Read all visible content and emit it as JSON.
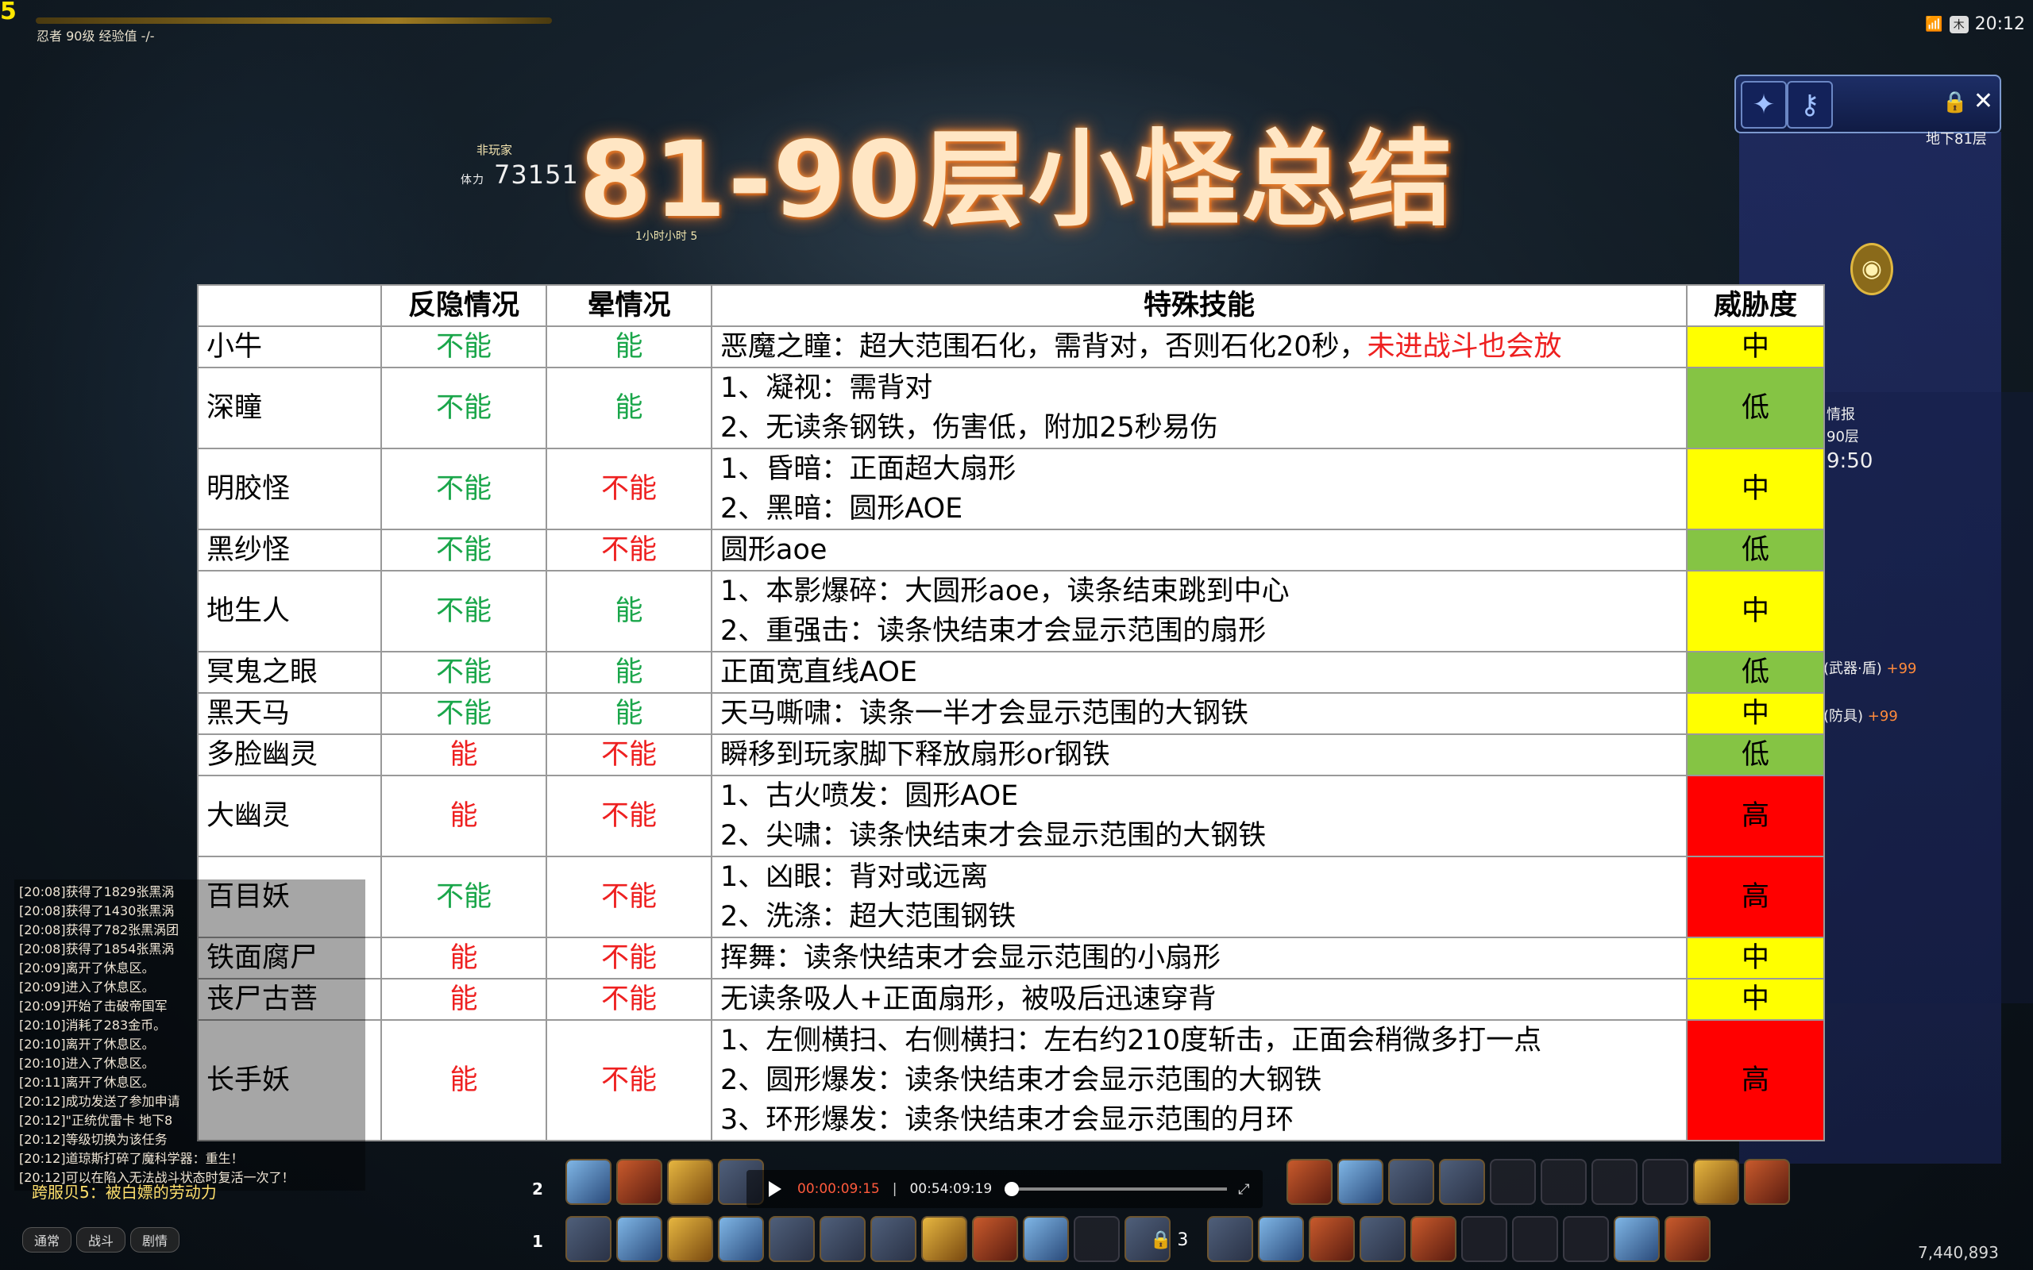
{
  "hud": {
    "corner_number": "5",
    "job_line": "忍者 90级  经验值 -/-",
    "clock": "20:12",
    "clock_badge": "木",
    "target_label": "非玩家",
    "target_hp_label": "体力",
    "target_hp": "73151",
    "target_timer": "1小时小时 5",
    "floor": "地下81层",
    "gil": "7,440,893"
  },
  "title": "81-90层小怪总结",
  "table": {
    "headers": [
      "",
      "反隐情况",
      "晕情况",
      "特殊技能",
      "威胁度"
    ],
    "rows": [
      {
        "name": "小牛",
        "hidden": "不能",
        "hidden_ok": false,
        "stun": "能",
        "stun_ok": true,
        "skills": [
          "恶魔之瞳：超大范围石化，需背对，否则石化20秒，"
        ],
        "skill_warn": "未进战斗也会放",
        "threat": "中",
        "level": "mid"
      },
      {
        "name": "深瞳",
        "hidden": "不能",
        "hidden_ok": false,
        "stun": "能",
        "stun_ok": true,
        "skills": [
          "1、凝视：需背对",
          "2、无读条钢铁，伤害低，附加25秒易伤"
        ],
        "skill_warn": "",
        "threat": "低",
        "level": "low"
      },
      {
        "name": "明胶怪",
        "hidden": "不能",
        "hidden_ok": false,
        "stun": "不能",
        "stun_ok": false,
        "skills": [
          "1、昏暗：正面超大扇形",
          "2、黑暗：圆形AOE"
        ],
        "skill_warn": "",
        "threat": "中",
        "level": "mid"
      },
      {
        "name": "黑纱怪",
        "hidden": "不能",
        "hidden_ok": false,
        "stun": "不能",
        "stun_ok": false,
        "skills": [
          "圆形aoe"
        ],
        "skill_warn": "",
        "threat": "低",
        "level": "low"
      },
      {
        "name": "地生人",
        "hidden": "不能",
        "hidden_ok": false,
        "stun": "能",
        "stun_ok": true,
        "skills": [
          "1、本影爆碎：大圆形aoe，读条结束跳到中心",
          "2、重强击：读条快结束才会显示范围的扇形"
        ],
        "skill_warn": "",
        "threat": "中",
        "level": "mid"
      },
      {
        "name": "冥鬼之眼",
        "hidden": "不能",
        "hidden_ok": false,
        "stun": "能",
        "stun_ok": true,
        "skills": [
          "正面宽直线AOE"
        ],
        "skill_warn": "",
        "threat": "低",
        "level": "low"
      },
      {
        "name": "黑天马",
        "hidden": "不能",
        "hidden_ok": false,
        "stun": "能",
        "stun_ok": true,
        "skills": [
          "天马嘶啸：读条一半才会显示范围的大钢铁"
        ],
        "skill_warn": "",
        "threat": "中",
        "level": "mid"
      },
      {
        "name": "多脸幽灵",
        "hidden": "能",
        "hidden_ok": true,
        "stun": "不能",
        "stun_ok": false,
        "skills": [
          "瞬移到玩家脚下释放扇形or钢铁"
        ],
        "skill_warn": "",
        "threat": "低",
        "level": "low"
      },
      {
        "name": "大幽灵",
        "hidden": "能",
        "hidden_ok": true,
        "stun": "不能",
        "stun_ok": false,
        "skills": [
          "1、古火喷发：圆形AOE",
          "2、尖啸：读条快结束才会显示范围的大钢铁"
        ],
        "skill_warn": "",
        "threat": "高",
        "level": "high"
      },
      {
        "name": "百目妖",
        "hidden": "不能",
        "hidden_ok": false,
        "stun": "不能",
        "stun_ok": false,
        "skills": [
          "1、凶眼：背对或远离",
          "2、洗涤：超大范围钢铁"
        ],
        "skill_warn": "",
        "threat": "高",
        "level": "high"
      },
      {
        "name": "铁面腐尸",
        "hidden": "能",
        "hidden_ok": true,
        "stun": "不能",
        "stun_ok": false,
        "skills": [
          "挥舞：读条快结束才会显示范围的小扇形"
        ],
        "skill_warn": "",
        "threat": "中",
        "level": "mid"
      },
      {
        "name": "丧尸古菩",
        "hidden": "能",
        "hidden_ok": true,
        "stun": "不能",
        "stun_ok": false,
        "skills": [
          "无读条吸人+正面扇形，被吸后迅速穿背"
        ],
        "skill_warn": "",
        "threat": "中",
        "level": "mid"
      },
      {
        "name": "长手妖",
        "hidden": "能",
        "hidden_ok": true,
        "stun": "不能",
        "stun_ok": false,
        "skills": [
          "1、左侧横扫、右侧横扫：左右约210度斩击，正面会稍微多打一点",
          "2、圆形爆发：读条快结束才会显示范围的大钢铁",
          "3、环形爆发：读条快结束才会显示范围的月环"
        ],
        "skill_warn": "",
        "threat": "高",
        "level": "high"
      }
    ]
  },
  "chat": {
    "lines": [
      "[20:08]获得了1829张黑涡",
      "[20:08]获得了1430张黑涡",
      "[20:08]获得了782张黑涡团",
      "[20:08]获得了1854张黑涡",
      "[20:09]离开了休息区。",
      "[20:09]进入了休息区。",
      "[20:09]开始了击破帝国军",
      "[20:10]消耗了283金币。",
      "[20:10]离开了休息区。",
      "[20:10]进入了休息区。",
      "[20:11]离开了休息区。",
      "[20:12]成功发送了参加申请",
      "[20:12]\"正统优雷卡 地下8",
      "[20:12]等级切换为该任务",
      "[20:12]道琼斯打碎了魔科学器：重生！",
      "[20:12]可以在陷入无法战斗状态时复活一次了！"
    ],
    "channel": "跨服贝5：被白嫖的劳动力",
    "tabs": [
      "通常",
      "战斗",
      "剧情"
    ]
  },
  "player": {
    "current": "00:00:09:15",
    "duration": "00:54:09:19",
    "progress": 0.0
  },
  "hotbar": {
    "bar1_num": "2",
    "bar2_num": "1",
    "lock_num": "3"
  },
  "side_panel": {
    "info": "情报",
    "floor90": "90层",
    "time": "9:50",
    "weapon": "(武器·盾)",
    "weapon_plus": "+99",
    "armor": "(防具)",
    "armor_plus": "+99"
  }
}
